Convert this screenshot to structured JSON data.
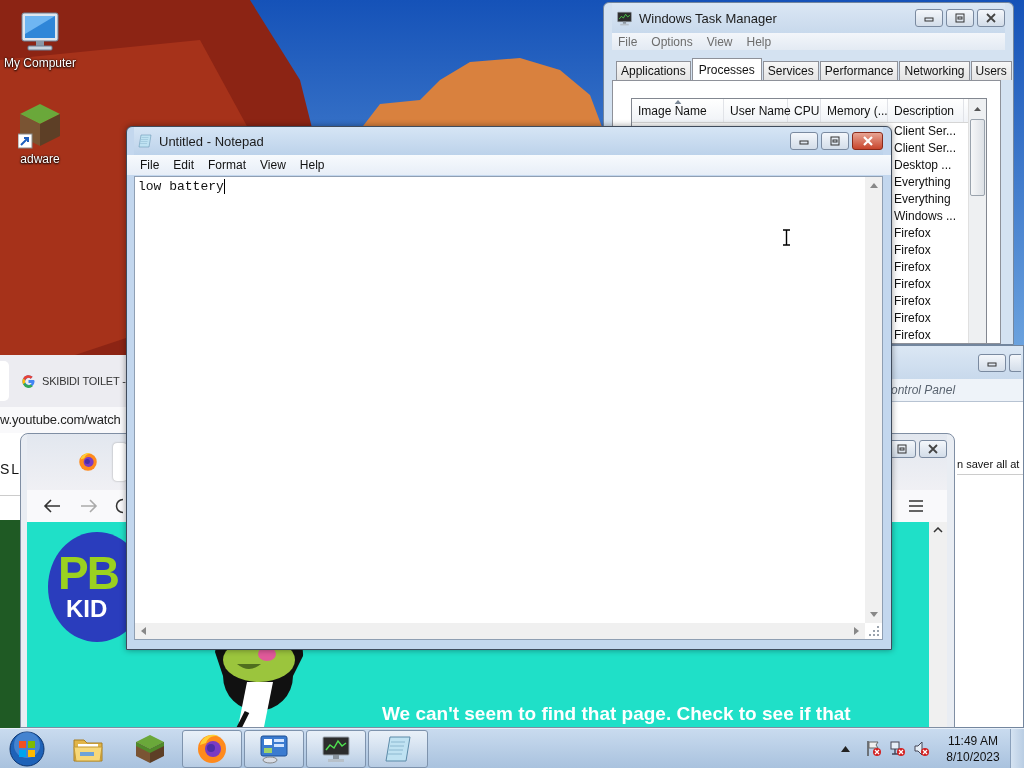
{
  "desktop_icons": [
    {
      "kind": "computer",
      "label": "My Computer"
    },
    {
      "kind": "block-shortcut",
      "label": "adware"
    }
  ],
  "youtube_window": {
    "tab_title": "SKIBIDI TOILET -",
    "url": "w.youtube.com/watch",
    "page_text": "S L"
  },
  "task_manager": {
    "title": "Windows Task Manager",
    "menu": [
      "File",
      "Options",
      "View",
      "Help"
    ],
    "tabs": [
      {
        "label": "Applications",
        "selected": false
      },
      {
        "label": "Processes",
        "selected": true
      },
      {
        "label": "Services",
        "selected": false
      },
      {
        "label": "Performance",
        "selected": false
      },
      {
        "label": "Networking",
        "selected": false
      },
      {
        "label": "Users",
        "selected": false
      }
    ],
    "columns": [
      {
        "label": "Image Name",
        "sorted": true
      },
      {
        "label": "User Name",
        "sorted": false
      },
      {
        "label": "CPU",
        "sorted": false
      },
      {
        "label": "Memory (...",
        "sorted": false
      },
      {
        "label": "Description",
        "sorted": false
      }
    ],
    "rows": [
      {
        "description": "Client Ser..."
      },
      {
        "description": "Client Ser..."
      },
      {
        "description": "Desktop ..."
      },
      {
        "description": "Everything"
      },
      {
        "description": "Everything"
      },
      {
        "description": "Windows ..."
      },
      {
        "description": "Firefox"
      },
      {
        "description": "Firefox"
      },
      {
        "description": "Firefox"
      },
      {
        "description": "Firefox"
      },
      {
        "description": "Firefox"
      },
      {
        "description": "Firefox"
      },
      {
        "description": "Firefox"
      }
    ]
  },
  "control_panel_window": {
    "address": "ontrol Panel",
    "page_text": "n saver all at"
  },
  "firefox_window": {
    "logo": {
      "line_1": "PB",
      "line_2": "KID"
    },
    "message": "We can't seem to find that page. Check to see if that"
  },
  "notepad": {
    "title": "Untitled - Notepad",
    "menu": [
      "File",
      "Edit",
      "Format",
      "View",
      "Help"
    ],
    "text": "low battery"
  },
  "taskbar": {
    "items": [
      {
        "kind": "folder",
        "running": false
      },
      {
        "kind": "grass-block",
        "running": false
      },
      {
        "kind": "browser",
        "running": true
      },
      {
        "kind": "control-panel",
        "running": true
      },
      {
        "kind": "task-manager",
        "running": true
      },
      {
        "kind": "notepad",
        "running": true
      }
    ],
    "tray_icons": [
      {
        "kind": "flag-error"
      },
      {
        "kind": "network-error"
      },
      {
        "kind": "volume-muted"
      }
    ],
    "clock": {
      "time": "11:49 AM",
      "date": "8/10/2023"
    }
  }
}
